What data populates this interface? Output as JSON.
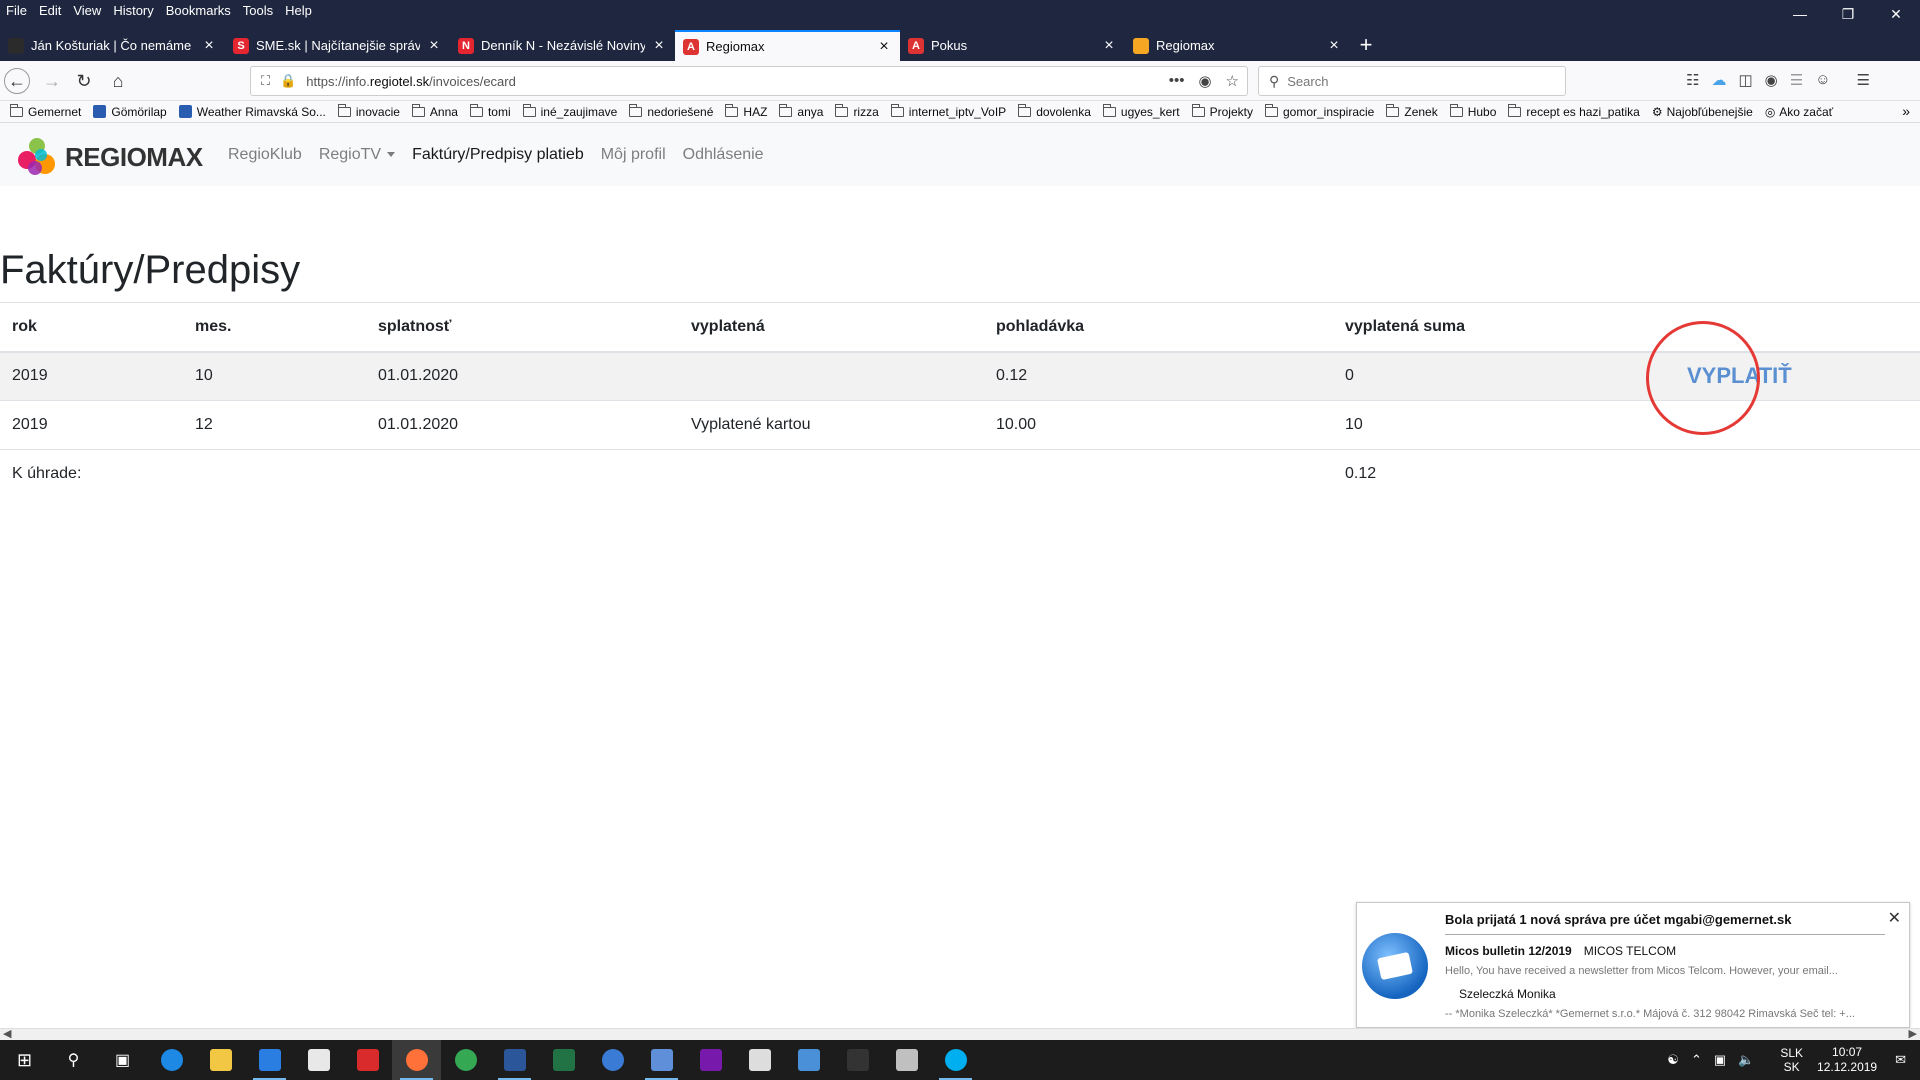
{
  "browser": {
    "menu": [
      "File",
      "Edit",
      "View",
      "History",
      "Bookmarks",
      "Tools",
      "Help"
    ],
    "tabs": [
      {
        "title": "Ján Košturiak | Čo nemáme to nepo",
        "favicon_color": "#2b2b2b",
        "glyph": ""
      },
      {
        "title": "SME.sk | Najčítanejšie správy na",
        "favicon_color": "#e3262f",
        "glyph": "S"
      },
      {
        "title": "Denník N - Nezávislé Noviny",
        "favicon_color": "#e3262f",
        "glyph": "N"
      },
      {
        "title": "Regiomax",
        "favicon_color": "#dd3333",
        "glyph": "A"
      },
      {
        "title": "Pokus",
        "favicon_color": "#dd3333",
        "glyph": "A"
      },
      {
        "title": "Regiomax",
        "favicon_color": "#f5a623",
        "glyph": ""
      }
    ],
    "active_tab": 3,
    "url_prefix": "https://info.",
    "url_domain": "regiotel.sk",
    "url_path": "/invoices/ecard",
    "search_placeholder": "Search",
    "bookmarks": [
      {
        "label": "Gemernet",
        "kind": "folder"
      },
      {
        "label": "Gömörilap",
        "kind": "site"
      },
      {
        "label": "Weather Rimavská So...",
        "kind": "site"
      },
      {
        "label": "inovacie",
        "kind": "folder"
      },
      {
        "label": "Anna",
        "kind": "folder"
      },
      {
        "label": "tomi",
        "kind": "folder"
      },
      {
        "label": "iné_zaujimave",
        "kind": "folder"
      },
      {
        "label": "nedoriešené",
        "kind": "folder"
      },
      {
        "label": "HAZ",
        "kind": "folder"
      },
      {
        "label": "anya",
        "kind": "folder"
      },
      {
        "label": "rizza",
        "kind": "folder"
      },
      {
        "label": "internet_iptv_VoIP",
        "kind": "folder"
      },
      {
        "label": "dovolenka",
        "kind": "folder"
      },
      {
        "label": "ugyes_kert",
        "kind": "folder"
      },
      {
        "label": "Projekty",
        "kind": "folder"
      },
      {
        "label": "gomor_inspiracie",
        "kind": "folder"
      },
      {
        "label": "Zenek",
        "kind": "folder"
      },
      {
        "label": "Hubo",
        "kind": "folder"
      },
      {
        "label": "recept es hazi_patika",
        "kind": "folder"
      },
      {
        "label": "Najobľúbenejšie",
        "kind": "gear"
      },
      {
        "label": "Ako začať",
        "kind": "globe"
      }
    ]
  },
  "site": {
    "logo_text": "REGIOMAX",
    "nav": [
      {
        "label": "RegioKlub",
        "active": false,
        "dropdown": false
      },
      {
        "label": "RegioTV",
        "active": false,
        "dropdown": true
      },
      {
        "label": "Faktúry/Predpisy platieb",
        "active": true,
        "dropdown": false
      },
      {
        "label": "Môj profil",
        "active": false,
        "dropdown": false
      },
      {
        "label": "Odhlásenie",
        "active": false,
        "dropdown": false
      }
    ]
  },
  "page": {
    "title": "Faktúry/Predpisy",
    "columns": [
      "rok",
      "mes.",
      "splatnosť",
      "vyplatená",
      "pohladávka",
      "vyplatená suma",
      ""
    ],
    "rows": [
      {
        "rok": "2019",
        "mes": "10",
        "splatnost": "01.01.2020",
        "vyplatena": "",
        "pohladavka": "0.12",
        "suma": "0",
        "action": "VYPLATIŤ"
      },
      {
        "rok": "2019",
        "mes": "12",
        "splatnost": "01.01.2020",
        "vyplatena": "Vyplatené kartou",
        "pohladavka": "10.00",
        "suma": "10",
        "action": ""
      }
    ],
    "total_label": "K úhrade:",
    "total_value": "0.12"
  },
  "notification": {
    "header": "Bola prijatá 1 nová správa pre účet mgabi@gemernet.sk",
    "subject": "Micos bulletin 12/2019",
    "sender_org": "MICOS TELCOM",
    "preview": "Hello, You have received a newsletter from Micos Telcom. However, your email...",
    "from": "Szeleczká Monika",
    "preview2": "-- *Monika Szeleczká* *Gemernet s.r.o.* Májová č. 312 98042 Rimavská Seč tel: +..."
  },
  "taskbar": {
    "apps": [
      {
        "name": "start",
        "color": "#ffffff",
        "running": false
      },
      {
        "name": "search",
        "color": "#ffffff",
        "running": false
      },
      {
        "name": "task-view",
        "color": "#ffffff",
        "running": false
      },
      {
        "name": "edge",
        "color": "#1e88e5",
        "running": false
      },
      {
        "name": "file-explorer",
        "color": "#f2c744",
        "running": false
      },
      {
        "name": "thunderbird",
        "color": "#2a7de1",
        "running": true
      },
      {
        "name": "store",
        "color": "#e8e8e8",
        "running": false
      },
      {
        "name": "acrobat",
        "color": "#d92b2b",
        "running": false
      },
      {
        "name": "firefox",
        "color": "#ff7139",
        "running": true
      },
      {
        "name": "chrome",
        "color": "#34a853",
        "running": false
      },
      {
        "name": "word",
        "color": "#2b579a",
        "running": true
      },
      {
        "name": "excel",
        "color": "#217346",
        "running": false
      },
      {
        "name": "app-blue",
        "color": "#3a7bd5",
        "running": false
      },
      {
        "name": "network-app",
        "color": "#5f8fd8",
        "running": true
      },
      {
        "name": "onenote",
        "color": "#7719aa",
        "running": false
      },
      {
        "name": "mail",
        "color": "#dddddd",
        "running": false
      },
      {
        "name": "remote-desktop",
        "color": "#4a90d9",
        "running": false
      },
      {
        "name": "terminal",
        "color": "#333333",
        "running": false
      },
      {
        "name": "paint",
        "color": "#c0c0c0",
        "running": false
      },
      {
        "name": "skype",
        "color": "#00aff0",
        "running": true
      }
    ],
    "lang_top": "SLK",
    "lang_bottom": "SK",
    "time": "10:07",
    "date": "12.12.2019"
  }
}
